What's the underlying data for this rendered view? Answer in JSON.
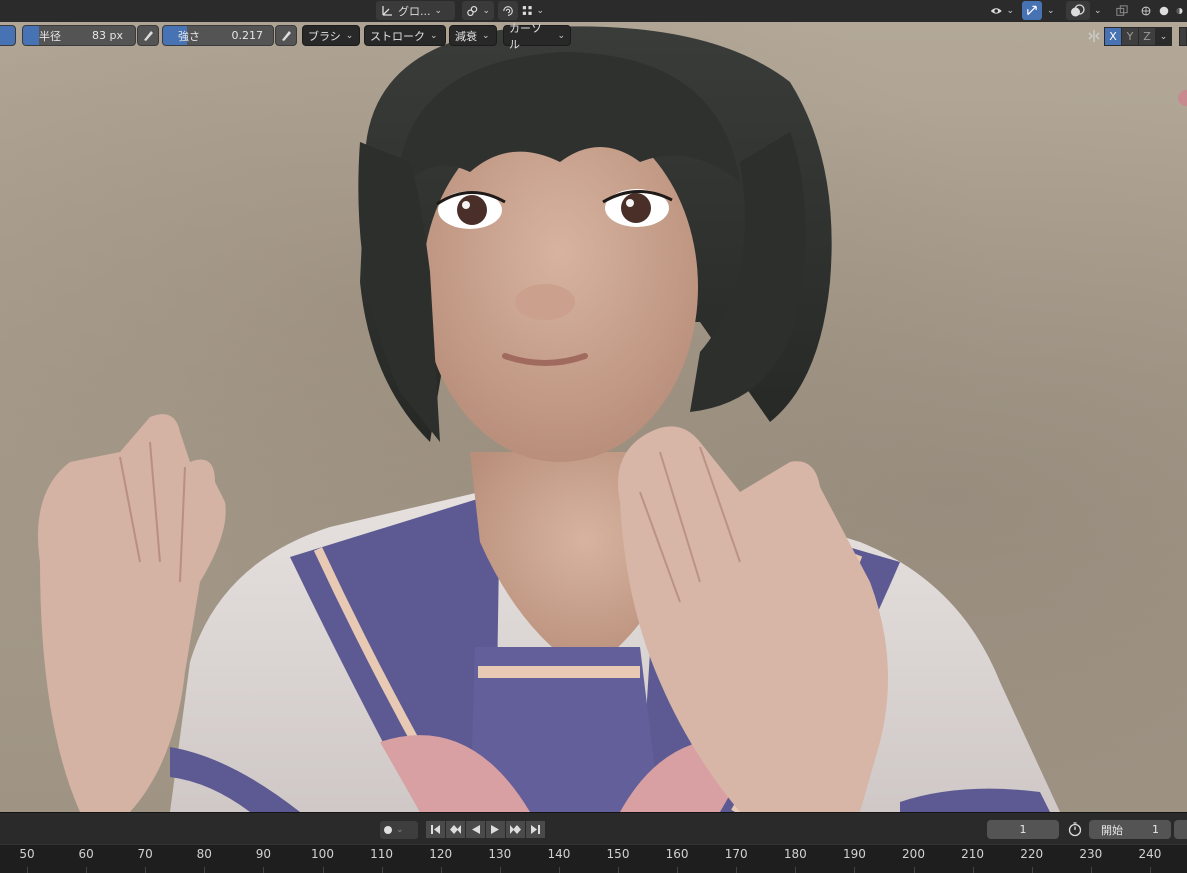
{
  "header": {
    "transform_orientation": "グロ...",
    "icons": [
      "transform-axes-icon",
      "link-icon",
      "proportional-edit-icon",
      "snap-grid-icon",
      "visibility-eye-icon",
      "gizmo-icon",
      "overlay-icon",
      "xray-icon",
      "shading-wireframe-icon",
      "shading-solid-icon",
      "shading-material-icon"
    ]
  },
  "toolbar": {
    "radius_label": "半径",
    "radius_value": "83 px",
    "strength_label": "強さ",
    "strength_value": "0.217",
    "strength_fraction": 0.217,
    "brush_menu": "ブラシ",
    "stroke_menu": "ストローク",
    "falloff_menu": "減衰",
    "cursor_menu": "カーソル",
    "axes": [
      "X",
      "Y",
      "Z"
    ],
    "active_axis": "X",
    "accent": "#4772b3"
  },
  "timeline": {
    "current_frame": "1",
    "start_label": "開始",
    "start_value": "1",
    "ticks": [
      "50",
      "60",
      "70",
      "80",
      "90",
      "100",
      "110",
      "120",
      "130",
      "140",
      "150",
      "160",
      "170",
      "180",
      "190",
      "200",
      "210",
      "220",
      "230",
      "240"
    ]
  }
}
